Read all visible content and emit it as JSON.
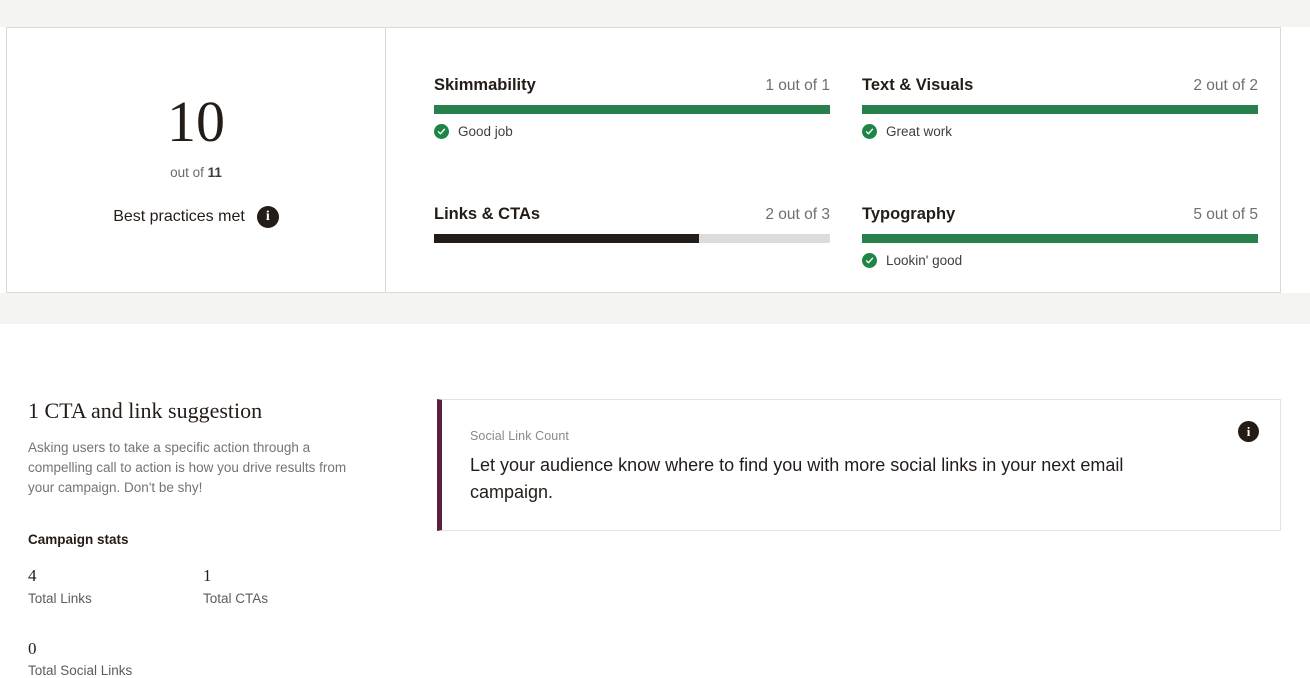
{
  "score_panel": {
    "score": "10",
    "out_of_prefix": "out of ",
    "out_of_value": "11",
    "best_practices_label": "Best practices met",
    "info_icon_glyph": "i",
    "metrics": [
      {
        "name": "Skimmability",
        "score_text": "1 out of 1",
        "earned": 1,
        "total": 1,
        "fill_percent": 100,
        "bar_color": "#28804a",
        "status": "Good job",
        "status_icon": "check-circle-icon"
      },
      {
        "name": "Text & Visuals",
        "score_text": "2 out of 2",
        "earned": 2,
        "total": 2,
        "fill_percent": 100,
        "bar_color": "#28804a",
        "status": "Great work",
        "status_icon": "check-circle-icon"
      },
      {
        "name": "Links & CTAs",
        "score_text": "2 out of 3",
        "earned": 2,
        "total": 3,
        "fill_percent": 67,
        "bar_color": "#241c17",
        "status": "",
        "status_icon": ""
      },
      {
        "name": "Typography",
        "score_text": "5 out of 5",
        "earned": 5,
        "total": 5,
        "fill_percent": 100,
        "bar_color": "#28804a",
        "status": "Lookin' good",
        "status_icon": "check-circle-icon"
      }
    ]
  },
  "suggestion": {
    "heading": "1 CTA and link suggestion",
    "body": "Asking users to take a specific action through a compelling call to action is how you drive results from your campaign. Don't be shy!",
    "stats_heading": "Campaign stats",
    "stats": [
      {
        "value": "4",
        "label": "Total Links"
      },
      {
        "value": "1",
        "label": "Total CTAs"
      },
      {
        "value": "0",
        "label": "Total Social Links"
      }
    ],
    "card": {
      "kicker": "Social Link Count",
      "text": "Let your audience know where to find you with more social links in your next email campaign.",
      "accent_color": "#5b1f3f",
      "info_icon_glyph": "i"
    }
  }
}
